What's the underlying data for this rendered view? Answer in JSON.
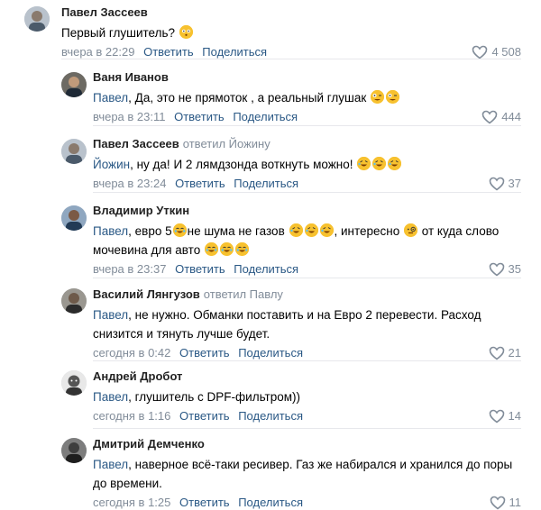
{
  "comments": [
    {
      "author": "Павел Зассеев",
      "replied": "",
      "mention": "",
      "text_parts": [
        "Первый глушитель?"
      ],
      "emojis": [
        "flushed"
      ],
      "date": "вчера в 22:29",
      "reply_label": "Ответить",
      "share_label": "Поделиться",
      "likes": "4 508"
    },
    {
      "author": "Ваня Иванов",
      "replied": "",
      "mention": "Павел",
      "text_parts": [
        ", Да, это не прямоток , а реальный глушак"
      ],
      "emojis": [
        "crazy",
        "crazy"
      ],
      "date": "вчера в 23:11",
      "reply_label": "Ответить",
      "share_label": "Поделиться",
      "likes": "444"
    },
    {
      "author": "Павел Зассеев",
      "replied": "ответил Йожину",
      "mention": "Йожин",
      "text_parts": [
        ", ну да! И 2 лямдзонда воткнуть можно!"
      ],
      "emojis": [
        "rofl",
        "rofl",
        "rofl"
      ],
      "date": "вчера в 23:24",
      "reply_label": "Ответить",
      "share_label": "Поделиться",
      "likes": "37"
    },
    {
      "author": "Владимир Уткин",
      "replied": "",
      "mention": "Павел",
      "text_parts": [
        ", евро 5",
        "не шума не газов ",
        ", интересно ",
        " от куда слово мочевина для авто "
      ],
      "emojis_inline": [
        "joy",
        "rofl-3",
        "monocle",
        "joy-3"
      ],
      "date": "вчера в 23:37",
      "reply_label": "Ответить",
      "share_label": "Поделиться",
      "likes": "35"
    },
    {
      "author": "Василий Лянгузов",
      "replied": "ответил Павлу",
      "mention": "Павел",
      "text_parts": [
        ", не нужно. Обманки поставить и на Евро 2 перевести. Расход снизится и тянуть лучше будет."
      ],
      "emojis": [],
      "date": "сегодня в 0:42",
      "reply_label": "Ответить",
      "share_label": "Поделиться",
      "likes": "21"
    },
    {
      "author": "Андрей Дробот",
      "replied": "",
      "mention": "Павел",
      "text_parts": [
        ", глушитель с DPF-фильтром))"
      ],
      "emojis": [],
      "date": "сегодня в 1:16",
      "reply_label": "Ответить",
      "share_label": "Поделиться",
      "likes": "14"
    },
    {
      "author": "Дмитрий Демченко",
      "replied": "",
      "mention": "Павел",
      "text_parts": [
        ", наверное всё-таки ресивер. Газ же набирался и хранился до поры до времени."
      ],
      "emojis": [],
      "date": "сегодня в 1:25",
      "reply_label": "Ответить",
      "share_label": "Поделиться",
      "likes": "11"
    }
  ],
  "colors": {
    "link": "#2a5885",
    "muted": "#818c99",
    "separator": "#e7e8ec",
    "emoji": "#f7c12f"
  }
}
